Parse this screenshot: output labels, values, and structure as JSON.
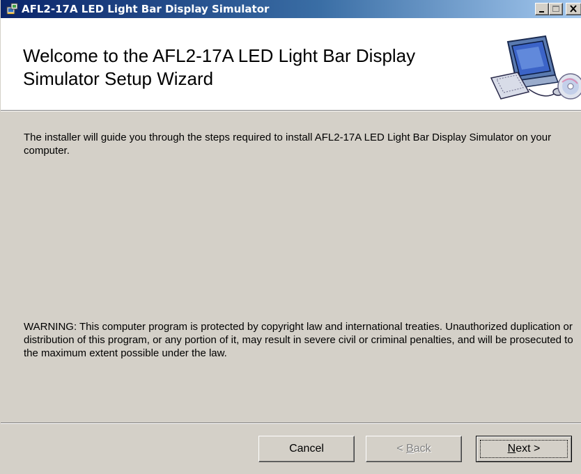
{
  "window": {
    "title": "AFL2-17A LED Light Bar Display Simulator",
    "controls": [
      "minimize",
      "maximize",
      "close"
    ]
  },
  "header": {
    "title": "Welcome to the AFL2-17A LED Light Bar Display Simulator Setup Wizard",
    "graphic": "computer-with-disc-icon"
  },
  "body": {
    "intro": "The installer will guide you through the steps required to install AFL2-17A LED Light Bar Display Simulator on your computer.",
    "warning": "WARNING: This computer program is protected by copyright law and international treaties. Unauthorized duplication or distribution of this program, or any portion of it, may result in severe civil or criminal penalties, and will be prosecuted to the maximum extent possible under the law."
  },
  "buttons": {
    "cancel": "Cancel",
    "back_prefix": "< ",
    "back_mnemonic": "B",
    "back_rest": "ack",
    "next_mnemonic": "N",
    "next_rest": "ext >"
  },
  "colors": {
    "titlebar_start": "#0a246a",
    "titlebar_end": "#a6caf0",
    "dialog_face": "#d4d0c8",
    "header_bg": "#ffffff",
    "disabled_text": "#808080"
  }
}
